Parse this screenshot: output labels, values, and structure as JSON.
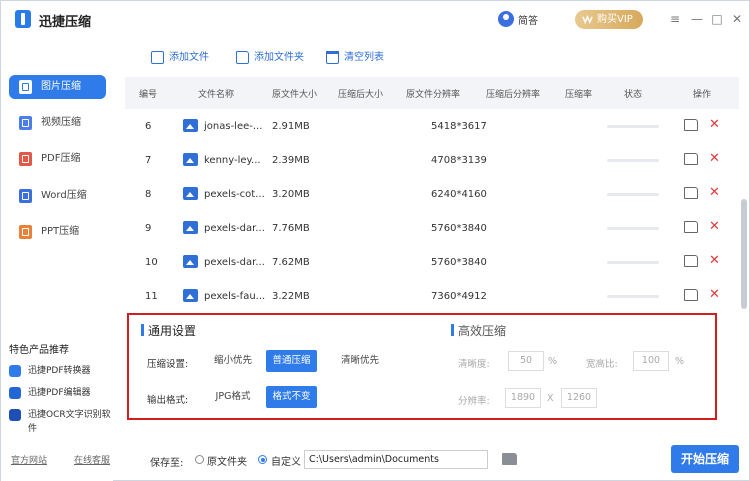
{
  "app": {
    "title": "迅捷压缩",
    "username": "简答",
    "vip_label": "购买VIP"
  },
  "window_controls": [
    "≡",
    "—",
    "□",
    "✕"
  ],
  "sidebar": {
    "items": [
      {
        "label": "图片压缩",
        "icon": "image-icon",
        "active": true
      },
      {
        "label": "视频压缩",
        "icon": "video-icon",
        "active": false
      },
      {
        "label": "PDF压缩",
        "icon": "pdf-icon",
        "active": false
      },
      {
        "label": "Word压缩",
        "icon": "word-icon",
        "active": false
      },
      {
        "label": "PPT压缩",
        "icon": "ppt-icon",
        "active": false
      }
    ],
    "recommend_title": "特色产品推荐",
    "recommend": [
      "迅捷PDF转换器",
      "迅捷PDF编辑器",
      "迅捷OCR文字识别软件"
    ],
    "links": [
      "官方网站",
      "在线客服"
    ]
  },
  "toolbar": {
    "add_file": "添加文件",
    "add_folder": "添加文件夹",
    "clear_list": "清空列表"
  },
  "table": {
    "headers": [
      "编号",
      "文件名称",
      "原文件大小",
      "压缩后大小",
      "原文件分辨率",
      "压缩后分辨率",
      "压缩率",
      "状态",
      "操作"
    ],
    "rows": [
      {
        "no": "6",
        "name": "jonas-lee-...",
        "size": "2.91MB",
        "res": "5418*3617"
      },
      {
        "no": "7",
        "name": "kenny-ley...",
        "size": "2.39MB",
        "res": "4708*3139"
      },
      {
        "no": "8",
        "name": "pexels-cot...",
        "size": "3.20MB",
        "res": "6240*4160"
      },
      {
        "no": "9",
        "name": "pexels-dar...",
        "size": "7.76MB",
        "res": "5760*3840"
      },
      {
        "no": "10",
        "name": "pexels-dar...",
        "size": "7.62MB",
        "res": "5760*3840"
      },
      {
        "no": "11",
        "name": "pexels-fau...",
        "size": "3.22MB",
        "res": "7360*4912"
      }
    ]
  },
  "settings": {
    "general_title": "通用设置",
    "compress_label": "压缩设置:",
    "compress_options": [
      "缩小优先",
      "普通压缩",
      "清晰优先"
    ],
    "compress_selected": 1,
    "format_label": "输出格式:",
    "format_options": [
      "JPG格式",
      "格式不变"
    ],
    "format_selected": 1,
    "efficient_title": "高效压缩",
    "clarity_label": "清晰度:",
    "clarity_value": "50",
    "clarity_unit": "%",
    "ratio_label": "宽高比:",
    "ratio_value": "100",
    "ratio_unit": "%",
    "resolution_label": "分辨率:",
    "res_w": "1890",
    "res_x": "X",
    "res_h": "1260"
  },
  "bottom": {
    "save_to": "保存至:",
    "opt_original": "原文件夹",
    "opt_custom": "自定义",
    "path": "C:\\Users\\admin\\Documents",
    "start": "开始压缩"
  }
}
